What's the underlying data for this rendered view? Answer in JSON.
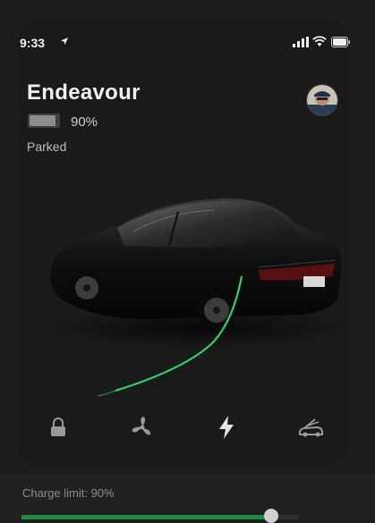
{
  "status_bar": {
    "time": "9:33",
    "icons": [
      "location-arrow-icon",
      "cellular-signal-icon",
      "wifi-icon",
      "battery-icon"
    ]
  },
  "vehicle": {
    "name": "Endeavour",
    "battery_percent_label": "90%",
    "battery_level": 0.9,
    "status": "Parked"
  },
  "quick_controls": [
    {
      "name": "lock-icon"
    },
    {
      "name": "fan-icon"
    },
    {
      "name": "charge-bolt-icon"
    },
    {
      "name": "frunk-open-icon"
    }
  ],
  "charge": {
    "limit_label": "Charge limit: 90%",
    "limit_level": 0.9
  },
  "colors": {
    "background": "#1c1d1c",
    "panel": "#191a19",
    "accent_green": "#1b8f3c",
    "cable_green": "#2fd06a",
    "text": "#f2f2f2",
    "muted_text": "#8e8e8e"
  }
}
